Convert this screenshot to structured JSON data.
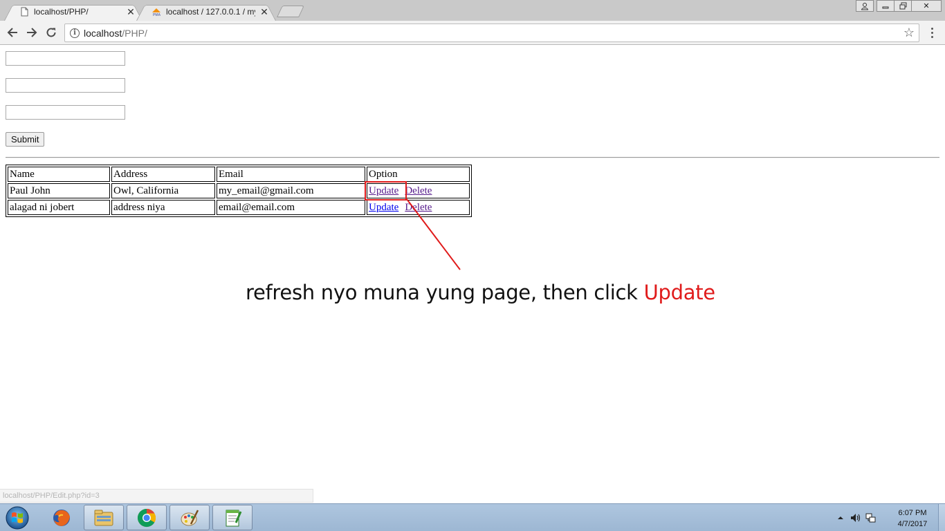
{
  "browser": {
    "tabs": [
      {
        "title": "localhost/PHP/",
        "favicon": "page-icon",
        "active": true
      },
      {
        "title": "localhost / 127.0.0.1 / my",
        "favicon": "phpmyadmin-icon",
        "active": false
      }
    ],
    "address": {
      "host": "localhost",
      "path": "/PHP/"
    }
  },
  "form": {
    "fields": [
      {
        "value": "",
        "placeholder": ""
      },
      {
        "value": "",
        "placeholder": ""
      },
      {
        "value": "",
        "placeholder": ""
      }
    ],
    "submit_label": "Submit"
  },
  "table": {
    "headers": [
      "Name",
      "Address",
      "Email",
      "Option"
    ],
    "rows": [
      {
        "name": "Paul John",
        "address": "Owl, California",
        "email": "my_email@gmail.com",
        "update": "Update",
        "delete": "Delete"
      },
      {
        "name": "alagad ni jobert",
        "address": "address niya",
        "email": "email@email.com",
        "update": "Update",
        "delete": "Delete"
      }
    ]
  },
  "annotation": {
    "text": "refresh nyo muna yung page, then click ",
    "highlight": "Update",
    "color": "#e01b1b"
  },
  "status_url": "localhost/PHP/Edit.php?id=3",
  "taskbar": {
    "apps": [
      "windows-start-icon",
      "firefox-icon",
      "explorer-icon",
      "chrome-icon",
      "paint-icon",
      "notepadpp-icon"
    ],
    "clock": {
      "time": "6:07 PM",
      "date": "4/7/2017"
    }
  }
}
